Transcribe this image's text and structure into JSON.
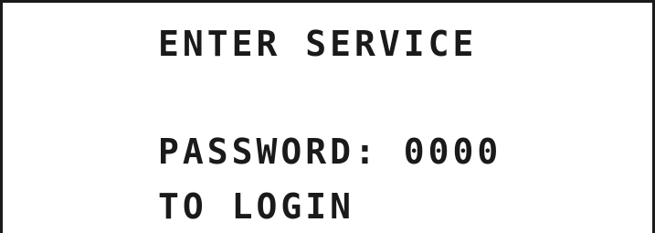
{
  "display": {
    "line1": "ENTER SERVICE",
    "line3": "PASSWORD: 0000",
    "line4": "TO LOGIN"
  }
}
